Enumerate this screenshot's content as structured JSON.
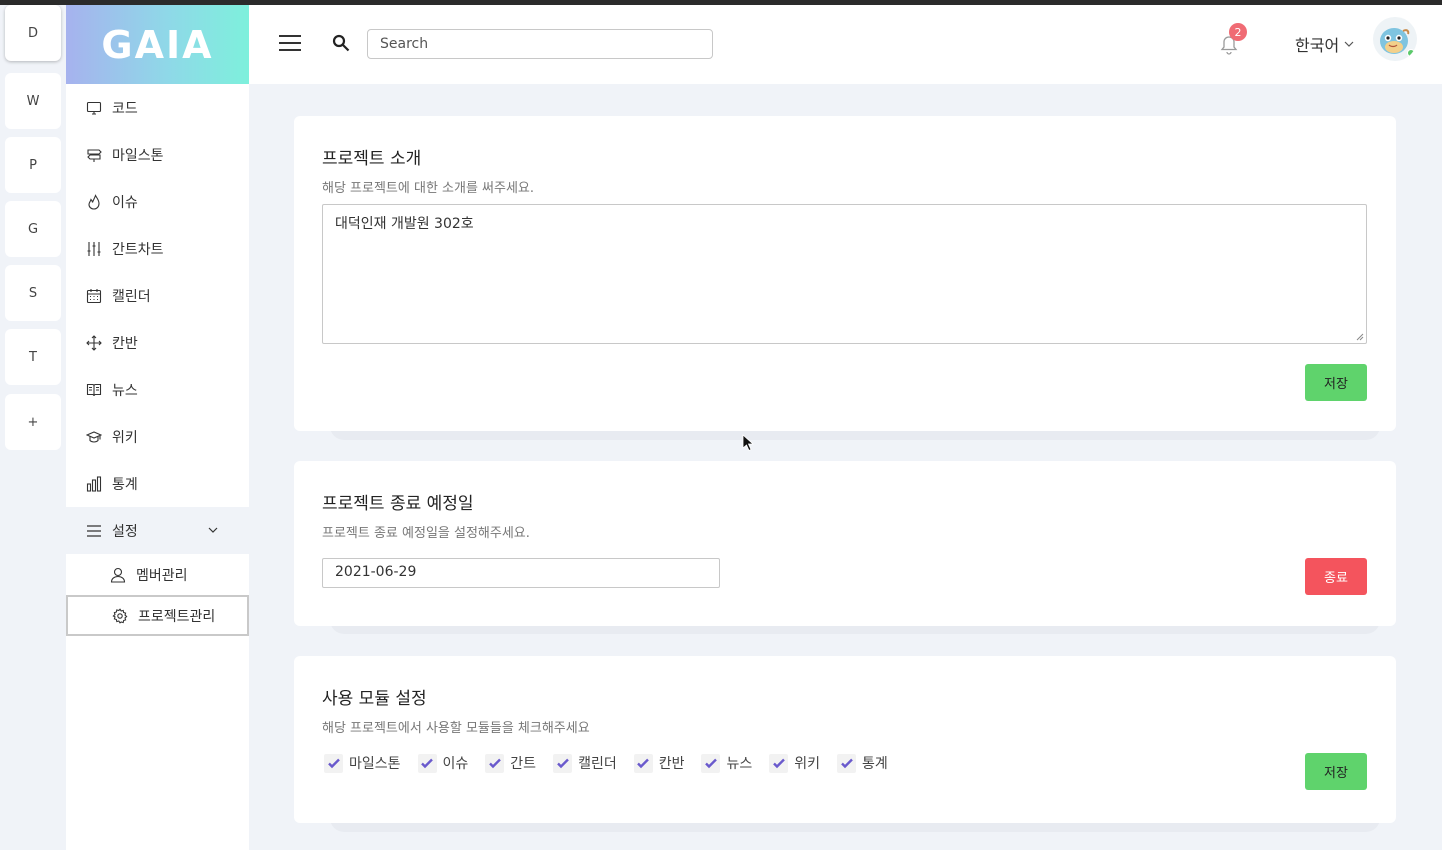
{
  "workspaces": [
    "D",
    "W",
    "P",
    "G",
    "S",
    "T",
    "+"
  ],
  "logo": "GAIA",
  "nav": {
    "items": [
      {
        "label": "코드",
        "icon": "monitor-icon"
      },
      {
        "label": "마일스톤",
        "icon": "signpost-icon"
      },
      {
        "label": "이슈",
        "icon": "fire-icon"
      },
      {
        "label": "간트차트",
        "icon": "sliders-icon"
      },
      {
        "label": "캘린더",
        "icon": "calendar-icon"
      },
      {
        "label": "칸반",
        "icon": "move-icon"
      },
      {
        "label": "뉴스",
        "icon": "book-icon"
      },
      {
        "label": "위키",
        "icon": "graduation-cap-icon"
      },
      {
        "label": "통계",
        "icon": "bar-chart-icon"
      }
    ],
    "settings": {
      "label": "설정",
      "icon": "menu-icon",
      "children": [
        {
          "label": "멤버관리",
          "icon": "user-icon"
        },
        {
          "label": "프로젝트관리",
          "icon": "gear-icon"
        }
      ]
    }
  },
  "header": {
    "search_placeholder": "Search",
    "notification_count": "2",
    "language": "한국어"
  },
  "intro": {
    "title": "프로젝트 소개",
    "description": "해당 프로젝트에 대한 소개를 써주세요.",
    "value": "대덕인재 개발원 302호",
    "save_label": "저장"
  },
  "end_date": {
    "title": "프로젝트 종료 예정일",
    "description": "프로젝트 종료 예정일을 설정해주세요.",
    "value": "2021-06-29",
    "end_label": "종료"
  },
  "modules": {
    "title": "사용 모듈 설정",
    "description": "해당 프로젝트에서 사용할 모듈들을 체크해주세요",
    "items": [
      {
        "label": "마일스톤",
        "checked": true
      },
      {
        "label": "이슈",
        "checked": true
      },
      {
        "label": "간트",
        "checked": true
      },
      {
        "label": "캘린더",
        "checked": true
      },
      {
        "label": "칸반",
        "checked": true
      },
      {
        "label": "뉴스",
        "checked": true
      },
      {
        "label": "위키",
        "checked": true
      },
      {
        "label": "통계",
        "checked": true
      }
    ],
    "save_label": "저장"
  },
  "colors": {
    "accent_green": "#5fd36c",
    "danger_red": "#f4545d",
    "check_purple": "#6a5acd",
    "badge": "#f06b74"
  }
}
